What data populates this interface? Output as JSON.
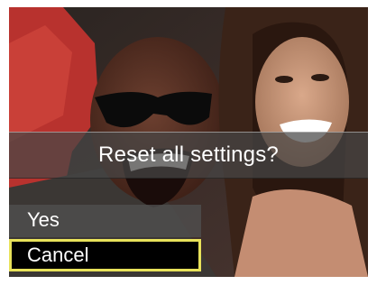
{
  "dialog": {
    "question": "Reset all settings?"
  },
  "options": [
    {
      "label": "Yes",
      "selected": false
    },
    {
      "label": "Cancel",
      "selected": true
    }
  ],
  "colors": {
    "highlight_border": "#e8e25a",
    "overlay": "#464646"
  }
}
